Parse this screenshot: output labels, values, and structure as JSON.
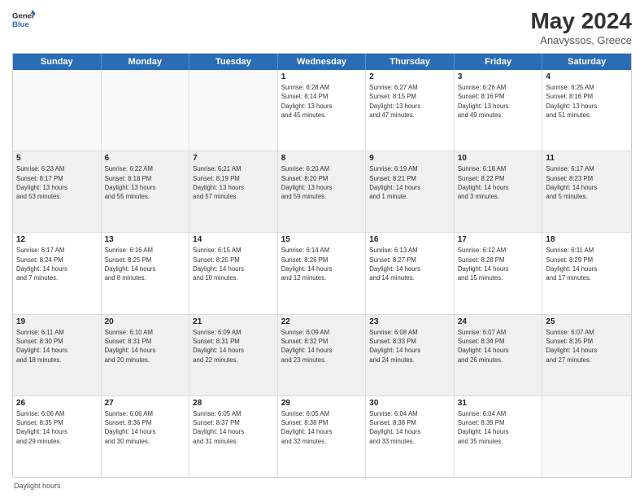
{
  "header": {
    "logo_line1": "General",
    "logo_line2": "Blue",
    "month_year": "May 2024",
    "location": "Anavyssos, Greece"
  },
  "days_of_week": [
    "Sunday",
    "Monday",
    "Tuesday",
    "Wednesday",
    "Thursday",
    "Friday",
    "Saturday"
  ],
  "legend": "Daylight hours",
  "weeks": [
    [
      {
        "day": "",
        "info": "",
        "empty": true
      },
      {
        "day": "",
        "info": "",
        "empty": true
      },
      {
        "day": "",
        "info": "",
        "empty": true
      },
      {
        "day": "1",
        "info": "Sunrise: 6:28 AM\nSunset: 8:14 PM\nDaylight: 13 hours\nand 45 minutes.",
        "empty": false
      },
      {
        "day": "2",
        "info": "Sunrise: 6:27 AM\nSunset: 8:15 PM\nDaylight: 13 hours\nand 47 minutes.",
        "empty": false
      },
      {
        "day": "3",
        "info": "Sunrise: 6:26 AM\nSunset: 8:16 PM\nDaylight: 13 hours\nand 49 minutes.",
        "empty": false
      },
      {
        "day": "4",
        "info": "Sunrise: 6:25 AM\nSunset: 8:16 PM\nDaylight: 13 hours\nand 51 minutes.",
        "empty": false
      }
    ],
    [
      {
        "day": "5",
        "info": "Sunrise: 6:23 AM\nSunset: 8:17 PM\nDaylight: 13 hours\nand 53 minutes.",
        "empty": false
      },
      {
        "day": "6",
        "info": "Sunrise: 6:22 AM\nSunset: 8:18 PM\nDaylight: 13 hours\nand 55 minutes.",
        "empty": false
      },
      {
        "day": "7",
        "info": "Sunrise: 6:21 AM\nSunset: 8:19 PM\nDaylight: 13 hours\nand 57 minutes.",
        "empty": false
      },
      {
        "day": "8",
        "info": "Sunrise: 6:20 AM\nSunset: 8:20 PM\nDaylight: 13 hours\nand 59 minutes.",
        "empty": false
      },
      {
        "day": "9",
        "info": "Sunrise: 6:19 AM\nSunset: 8:21 PM\nDaylight: 14 hours\nand 1 minute.",
        "empty": false
      },
      {
        "day": "10",
        "info": "Sunrise: 6:18 AM\nSunset: 8:22 PM\nDaylight: 14 hours\nand 3 minutes.",
        "empty": false
      },
      {
        "day": "11",
        "info": "Sunrise: 6:17 AM\nSunset: 8:23 PM\nDaylight: 14 hours\nand 5 minutes.",
        "empty": false
      }
    ],
    [
      {
        "day": "12",
        "info": "Sunrise: 6:17 AM\nSunset: 8:24 PM\nDaylight: 14 hours\nand 7 minutes.",
        "empty": false
      },
      {
        "day": "13",
        "info": "Sunrise: 6:16 AM\nSunset: 8:25 PM\nDaylight: 14 hours\nand 8 minutes.",
        "empty": false
      },
      {
        "day": "14",
        "info": "Sunrise: 6:15 AM\nSunset: 8:25 PM\nDaylight: 14 hours\nand 10 minutes.",
        "empty": false
      },
      {
        "day": "15",
        "info": "Sunrise: 6:14 AM\nSunset: 8:26 PM\nDaylight: 14 hours\nand 12 minutes.",
        "empty": false
      },
      {
        "day": "16",
        "info": "Sunrise: 6:13 AM\nSunset: 8:27 PM\nDaylight: 14 hours\nand 14 minutes.",
        "empty": false
      },
      {
        "day": "17",
        "info": "Sunrise: 6:12 AM\nSunset: 8:28 PM\nDaylight: 14 hours\nand 15 minutes.",
        "empty": false
      },
      {
        "day": "18",
        "info": "Sunrise: 6:11 AM\nSunset: 8:29 PM\nDaylight: 14 hours\nand 17 minutes.",
        "empty": false
      }
    ],
    [
      {
        "day": "19",
        "info": "Sunrise: 6:11 AM\nSunset: 8:30 PM\nDaylight: 14 hours\nand 18 minutes.",
        "empty": false
      },
      {
        "day": "20",
        "info": "Sunrise: 6:10 AM\nSunset: 8:31 PM\nDaylight: 14 hours\nand 20 minutes.",
        "empty": false
      },
      {
        "day": "21",
        "info": "Sunrise: 6:09 AM\nSunset: 8:31 PM\nDaylight: 14 hours\nand 22 minutes.",
        "empty": false
      },
      {
        "day": "22",
        "info": "Sunrise: 6:09 AM\nSunset: 8:32 PM\nDaylight: 14 hours\nand 23 minutes.",
        "empty": false
      },
      {
        "day": "23",
        "info": "Sunrise: 6:08 AM\nSunset: 8:33 PM\nDaylight: 14 hours\nand 24 minutes.",
        "empty": false
      },
      {
        "day": "24",
        "info": "Sunrise: 6:07 AM\nSunset: 8:34 PM\nDaylight: 14 hours\nand 26 minutes.",
        "empty": false
      },
      {
        "day": "25",
        "info": "Sunrise: 6:07 AM\nSunset: 8:35 PM\nDaylight: 14 hours\nand 27 minutes.",
        "empty": false
      }
    ],
    [
      {
        "day": "26",
        "info": "Sunrise: 6:06 AM\nSunset: 8:35 PM\nDaylight: 14 hours\nand 29 minutes.",
        "empty": false
      },
      {
        "day": "27",
        "info": "Sunrise: 6:06 AM\nSunset: 8:36 PM\nDaylight: 14 hours\nand 30 minutes.",
        "empty": false
      },
      {
        "day": "28",
        "info": "Sunrise: 6:05 AM\nSunset: 8:37 PM\nDaylight: 14 hours\nand 31 minutes.",
        "empty": false
      },
      {
        "day": "29",
        "info": "Sunrise: 6:05 AM\nSunset: 8:38 PM\nDaylight: 14 hours\nand 32 minutes.",
        "empty": false
      },
      {
        "day": "30",
        "info": "Sunrise: 6:04 AM\nSunset: 8:38 PM\nDaylight: 14 hours\nand 33 minutes.",
        "empty": false
      },
      {
        "day": "31",
        "info": "Sunrise: 6:04 AM\nSunset: 8:39 PM\nDaylight: 14 hours\nand 35 minutes.",
        "empty": false
      },
      {
        "day": "",
        "info": "",
        "empty": true
      }
    ]
  ]
}
